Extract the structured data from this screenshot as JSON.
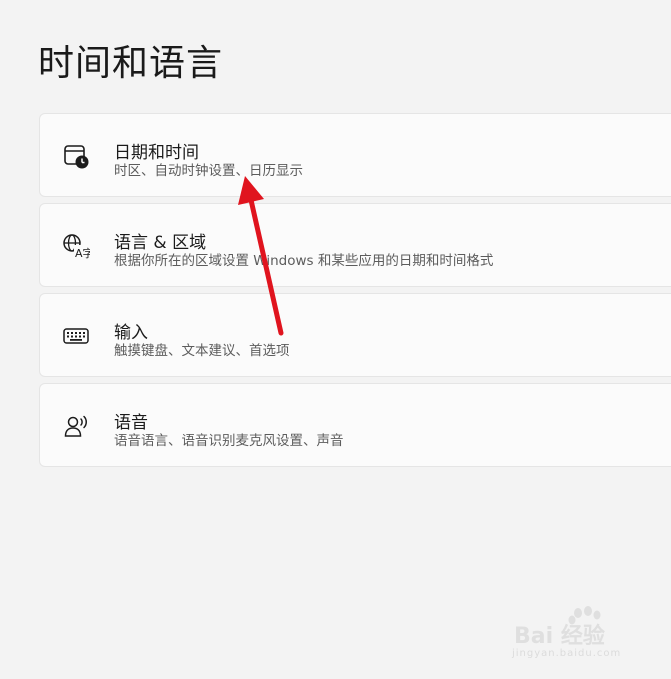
{
  "page": {
    "title": "时间和语言"
  },
  "items": [
    {
      "title": "日期和时间",
      "description": "时区、自动时钟设置、日历显示",
      "icon": "calendar-clock-icon"
    },
    {
      "title": "语言 & 区域",
      "description": "根据你所在的区域设置 Windows 和某些应用的日期和时间格式",
      "icon": "language-region-icon"
    },
    {
      "title": "输入",
      "description": "触摸键盘、文本建议、首选项",
      "icon": "keyboard-icon"
    },
    {
      "title": "语音",
      "description": "语音语言、语音识别麦克风设置、声音",
      "icon": "speech-icon"
    }
  ],
  "annotation": {
    "arrow_color": "#e0141e"
  },
  "watermark": {
    "logo": "Bai 经验",
    "url": "jingyan.baidu.com"
  }
}
